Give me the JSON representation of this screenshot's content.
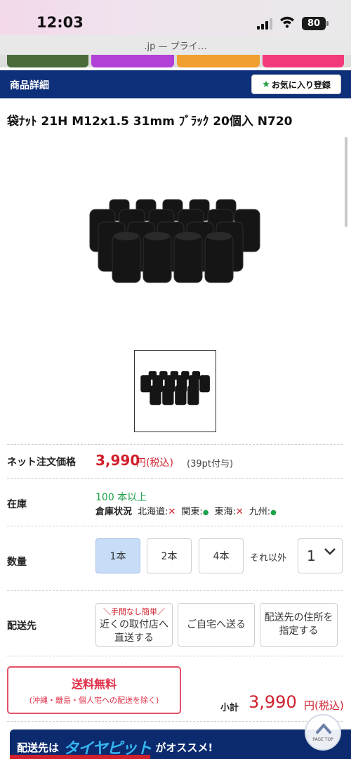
{
  "status_bar": {
    "time": "12:03",
    "battery": "80"
  },
  "browser": {
    "url_text": ".jp — プライ…"
  },
  "header": {
    "title": "商品詳細",
    "favorite_button": "お気に入り登録"
  },
  "product": {
    "title": "袋ﾅｯﾄ 21H M12x1.5 31mm ﾌﾞﾗｯｸ 20個入 N720"
  },
  "price": {
    "label": "ネット注文価格",
    "value": "3,990",
    "unit": "円(税込)",
    "points": "(39pt付与)"
  },
  "stock": {
    "label": "在庫",
    "quantity": "100 本以上",
    "warehouse_label": "倉庫状況",
    "regions": [
      {
        "name": "北海道:",
        "available": false
      },
      {
        "name": "関東:",
        "available": true
      },
      {
        "name": "東海:",
        "available": false
      },
      {
        "name": "九州:",
        "available": true
      }
    ]
  },
  "quantity": {
    "label": "数量",
    "options": [
      "1本",
      "2本",
      "4本"
    ],
    "selected": "1本",
    "other_label": "それ以外",
    "select_value": "1"
  },
  "shipping": {
    "label": "配送先",
    "options": [
      {
        "note": "＼手間なし簡単／",
        "line1": "近くの取付店へ",
        "line2": "直送する"
      },
      {
        "note": "",
        "line1": "ご自宅へ送る",
        "line2": ""
      },
      {
        "note": "",
        "line1": "配送先の住所を",
        "line2": "指定する"
      }
    ]
  },
  "free_shipping": {
    "title": "送料無料",
    "note": "(沖縄・離島・個人宅への配送を除く)"
  },
  "subtotal": {
    "label": "小計",
    "value": "3,990",
    "unit": "円(税込)"
  },
  "promo": {
    "prefix": "配送先は",
    "brand": "タイヤピット",
    "suffix": "がオススメ!"
  },
  "page_top": {
    "label": "PAGE TOP"
  },
  "colors": {
    "header_bg": "#0e2f7a",
    "price_red": "#d0202d",
    "stock_green": "#1fa24a",
    "selected_qty": "#c7dcf6"
  }
}
